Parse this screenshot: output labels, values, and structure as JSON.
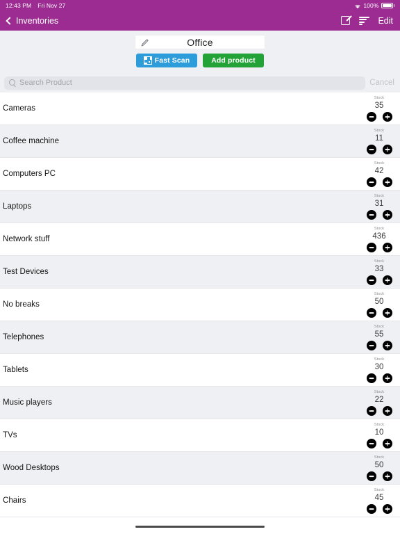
{
  "status_bar": {
    "time": "12:43 PM",
    "date": "Fri Nov 27",
    "wifi_icon": "wifi-icon",
    "battery_percent": "100%",
    "battery_icon": "battery-full-icon"
  },
  "nav_bar": {
    "back_icon": "chevron-left-icon",
    "back_label": "Inventories",
    "compose_icon": "compose-square-pencil-icon",
    "sort_icon": "sort-lines-icon",
    "edit_label": "Edit",
    "background_color": "#9c2c91"
  },
  "header": {
    "pencil_icon": "pencil-icon",
    "title_value": "Office",
    "fast_scan_label": "Fast Scan",
    "fast_scan_icon": "qr-code-icon",
    "fast_scan_color": "#2d9cdb",
    "add_product_label": "Add product",
    "add_product_color": "#23a337"
  },
  "search": {
    "icon": "search-icon",
    "placeholder": "Search Product",
    "value": "",
    "cancel_label": "Cancel"
  },
  "list": {
    "stock_label": "Stock",
    "decrement_icon": "minus-circle-icon",
    "increment_icon": "plus-circle-icon",
    "items": [
      {
        "name": "Cameras",
        "stock": "35"
      },
      {
        "name": "Coffee machine",
        "stock": "11"
      },
      {
        "name": "Computers PC",
        "stock": "42"
      },
      {
        "name": "Laptops",
        "stock": "31"
      },
      {
        "name": "Network stuff",
        "stock": "436"
      },
      {
        "name": "Test Devices",
        "stock": "33"
      },
      {
        "name": "No breaks",
        "stock": "50"
      },
      {
        "name": "Telephones",
        "stock": "55"
      },
      {
        "name": "Tablets",
        "stock": "30"
      },
      {
        "name": "Music players",
        "stock": "22"
      },
      {
        "name": "TVs",
        "stock": "10"
      },
      {
        "name": "Wood Desktops",
        "stock": "50"
      },
      {
        "name": "Chairs",
        "stock": "45"
      }
    ]
  },
  "home_indicator": "home-indicator"
}
